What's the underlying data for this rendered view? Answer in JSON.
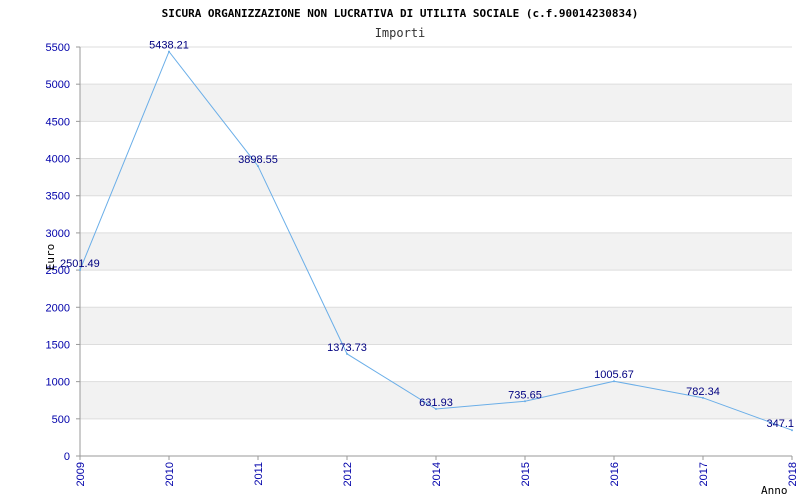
{
  "chart_data": {
    "type": "line",
    "title": "SICURA ORGANIZZAZIONE NON LUCRATIVA DI UTILITA SOCIALE (c.f.90014230834)",
    "subtitle": "Importi",
    "xlabel": "Anno",
    "ylabel": "Euro",
    "ylim": [
      0,
      5500
    ],
    "yticks": [
      "0",
      "500",
      "1000",
      "1500",
      "2000",
      "2500",
      "3000",
      "3500",
      "4000",
      "4500",
      "5000",
      "5500"
    ],
    "categories": [
      "2009",
      "2010",
      "2011",
      "2012",
      "2014",
      "2015",
      "2016",
      "2017",
      "2018"
    ],
    "values": [
      2501.49,
      5438.21,
      3898.55,
      1373.73,
      631.93,
      735.65,
      1005.67,
      782.34,
      347.1
    ],
    "data_labels": [
      "2501.49",
      "5438.21",
      "3898.55",
      "1373.73",
      "631.93",
      "735.65",
      "1005.67",
      "782.34",
      "347.1"
    ],
    "grid": true,
    "band_color": "#f2f2f2",
    "line_color": "#6aaee8",
    "legend": "none"
  }
}
